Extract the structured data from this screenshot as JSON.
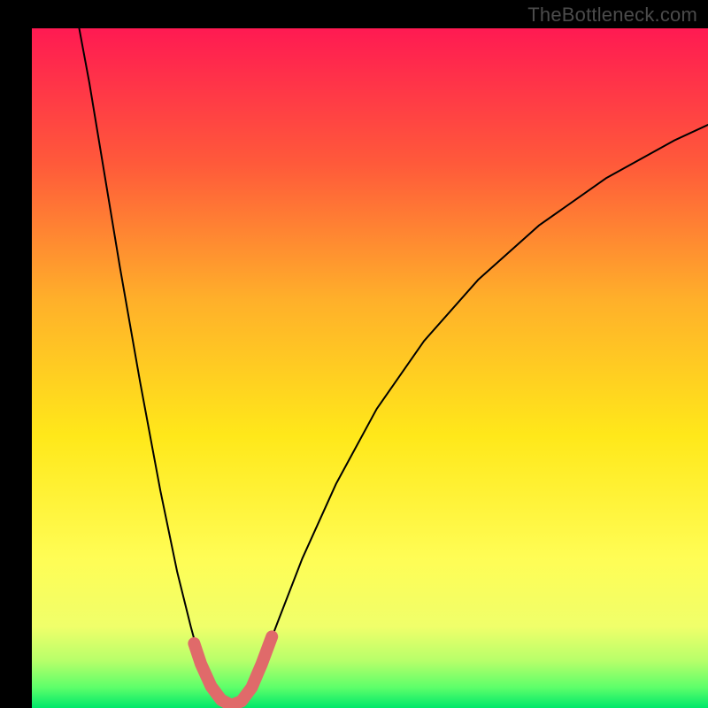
{
  "watermark": "TheBottleneck.com",
  "chart_data": {
    "type": "line",
    "title": "",
    "xlabel": "",
    "ylabel": "",
    "xlim": [
      0,
      100
    ],
    "ylim": [
      0,
      100
    ],
    "gradient_stops": [
      {
        "offset": 0.0,
        "color": "#ff1a52"
      },
      {
        "offset": 0.2,
        "color": "#ff5a3a"
      },
      {
        "offset": 0.4,
        "color": "#ffb02a"
      },
      {
        "offset": 0.6,
        "color": "#ffe81a"
      },
      {
        "offset": 0.78,
        "color": "#fffd55"
      },
      {
        "offset": 0.88,
        "color": "#f0ff6a"
      },
      {
        "offset": 0.93,
        "color": "#b8ff6a"
      },
      {
        "offset": 0.97,
        "color": "#5dff6a"
      },
      {
        "offset": 1.0,
        "color": "#00e86a"
      }
    ],
    "series": [
      {
        "name": "curve",
        "stroke": "#000000",
        "stroke_width": 2,
        "points": [
          {
            "x": 7.0,
            "y": 100.0
          },
          {
            "x": 8.5,
            "y": 92.0
          },
          {
            "x": 10.5,
            "y": 80.0
          },
          {
            "x": 13.0,
            "y": 65.0
          },
          {
            "x": 16.0,
            "y": 48.0
          },
          {
            "x": 19.0,
            "y": 32.0
          },
          {
            "x": 21.5,
            "y": 20.0
          },
          {
            "x": 23.5,
            "y": 12.0
          },
          {
            "x": 25.0,
            "y": 6.5
          },
          {
            "x": 26.5,
            "y": 3.2
          },
          {
            "x": 28.0,
            "y": 1.2
          },
          {
            "x": 29.5,
            "y": 0.4
          },
          {
            "x": 31.0,
            "y": 1.0
          },
          {
            "x": 32.5,
            "y": 3.0
          },
          {
            "x": 34.0,
            "y": 6.5
          },
          {
            "x": 36.5,
            "y": 13.0
          },
          {
            "x": 40.0,
            "y": 22.0
          },
          {
            "x": 45.0,
            "y": 33.0
          },
          {
            "x": 51.0,
            "y": 44.0
          },
          {
            "x": 58.0,
            "y": 54.0
          },
          {
            "x": 66.0,
            "y": 63.0
          },
          {
            "x": 75.0,
            "y": 71.0
          },
          {
            "x": 85.0,
            "y": 78.0
          },
          {
            "x": 95.0,
            "y": 83.5
          },
          {
            "x": 100.0,
            "y": 85.8
          }
        ]
      },
      {
        "name": "highlight-bottom",
        "stroke": "#e06a6a",
        "stroke_width": 14,
        "points": [
          {
            "x": 24.0,
            "y": 9.5
          },
          {
            "x": 25.0,
            "y": 6.5
          },
          {
            "x": 26.5,
            "y": 3.2
          },
          {
            "x": 28.0,
            "y": 1.2
          },
          {
            "x": 29.5,
            "y": 0.4
          },
          {
            "x": 31.0,
            "y": 1.0
          },
          {
            "x": 32.5,
            "y": 3.0
          },
          {
            "x": 34.0,
            "y": 6.5
          },
          {
            "x": 35.5,
            "y": 10.5
          }
        ]
      }
    ]
  }
}
